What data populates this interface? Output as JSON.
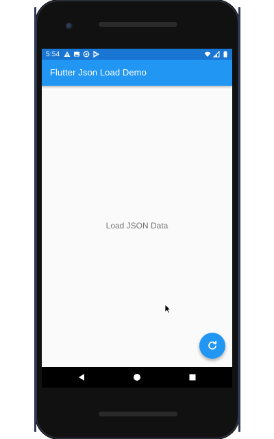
{
  "status_bar": {
    "time": "5:54",
    "left_icons": [
      "warning-icon",
      "image-icon",
      "sync-icon",
      "play-store-icon"
    ],
    "right_icons": [
      "wifi-icon",
      "signal-icon",
      "battery-icon"
    ]
  },
  "app_bar": {
    "title": "Flutter Json Load Demo"
  },
  "content": {
    "center_text": "Load JSON Data"
  },
  "fab": {
    "icon": "refresh-icon"
  },
  "nav": {
    "back": "back-icon",
    "home": "home-icon",
    "recents": "recents-icon"
  },
  "colors": {
    "primary": "#2196F3",
    "primary_dark": "#1976D2",
    "background": "#fafafa",
    "text_secondary": "#757575"
  }
}
